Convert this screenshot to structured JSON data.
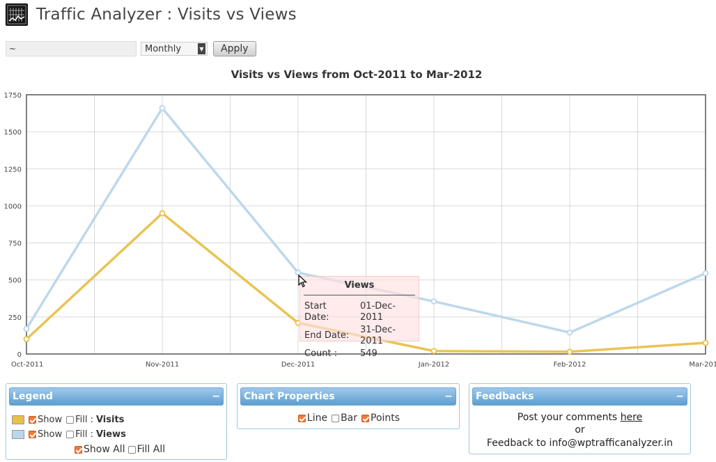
{
  "app": {
    "title": "Traffic Analyzer : Visits vs Views"
  },
  "controls": {
    "range_value": "~",
    "period_selected": "Monthly",
    "apply_label": "Apply"
  },
  "chart_data": {
    "type": "line",
    "title": "Visits vs Views from Oct-2011 to Mar-2012",
    "categories": [
      "Oct-2011",
      "Nov-2011",
      "Dec-2011",
      "Jan-2012",
      "Feb-2012",
      "Mar-2012"
    ],
    "ylim": [
      0,
      1750
    ],
    "yticks": [
      0,
      250,
      500,
      750,
      1000,
      1250,
      1500,
      1750
    ],
    "grid": true,
    "series": [
      {
        "name": "Visits",
        "color": "#e8c04a",
        "values": [
          100,
          950,
          210,
          20,
          15,
          75
        ]
      },
      {
        "name": "Views",
        "color": "#b9d6ea",
        "values": [
          170,
          1660,
          549,
          355,
          145,
          545
        ]
      }
    ],
    "tooltip": {
      "title": "Views",
      "start_label": "Start Date:",
      "start_value": "01-Dec-2011",
      "end_label": "End Date:",
      "end_value": "31-Dec-2011",
      "count_label": "Count :",
      "count_value": "549"
    }
  },
  "legend_panel": {
    "title": "Legend",
    "collapse": "−",
    "show_label": "Show",
    "fill_label": "Fill :",
    "visits_name": "Visits",
    "views_name": "Views",
    "show_all_label": "Show All",
    "fill_all_label": "Fill All",
    "visits_color": "#e8c04a",
    "views_color": "#b9d6ea"
  },
  "properties_panel": {
    "title": "Chart Properties",
    "collapse": "−",
    "line_label": "Line",
    "bar_label": "Bar",
    "points_label": "Points"
  },
  "feedback_panel": {
    "title": "Feedbacks",
    "collapse": "−",
    "post_text": "Post your comments",
    "here_link": "here",
    "or_text": "or",
    "email_text": "Feedback to info@wptrafficanalyzer.in"
  }
}
